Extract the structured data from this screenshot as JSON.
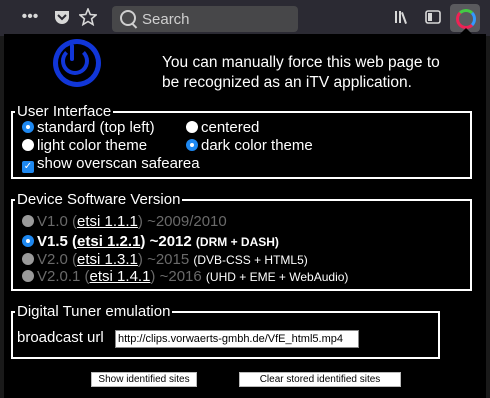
{
  "toolbar": {
    "more_icon": "•••",
    "pocket_icon": "pocket-icon",
    "star_icon": "star-icon",
    "search_placeholder": "Search",
    "library_icon": "library-icon",
    "sidebar_icon": "sidebar-icon",
    "extension_icon": "itv-extension-icon"
  },
  "popup": {
    "intro_text": "You can manually force this web page to be recognized as an iTV application.",
    "user_interface": {
      "legend": "User Interface",
      "opt_standard": "standard (top left)",
      "opt_centered": "centered",
      "opt_light": "light color theme",
      "opt_dark": "dark color theme",
      "opt_overscan": "show overscan safearea"
    },
    "device_software": {
      "legend": "Device Software Version",
      "versions": [
        {
          "name": "V1.0",
          "etsi": "etsi 1.1.1",
          "year": "~2009/2010",
          "note": ""
        },
        {
          "name": "V1.5",
          "etsi": "etsi 1.2.1",
          "year": "~2012",
          "note": "(DRM + DASH)"
        },
        {
          "name": "V2.0",
          "etsi": "etsi 1.3.1",
          "year": "~2015",
          "note": "(DVB-CSS + HTML5)"
        },
        {
          "name": "V2.0.1",
          "etsi": "etsi 1.4.1",
          "year": "~2016",
          "note": "(UHD + EME + WebAudio)"
        }
      ]
    },
    "tuner": {
      "legend": "Digital Tuner emulation",
      "url_label": "broadcast url",
      "url_value": "http://clips.vorwaerts-gmbh.de/VfE_html5.mp4"
    },
    "buttons": {
      "show_sites": "Show identified sites",
      "clear_sites": "Clear stored identified sites"
    }
  }
}
